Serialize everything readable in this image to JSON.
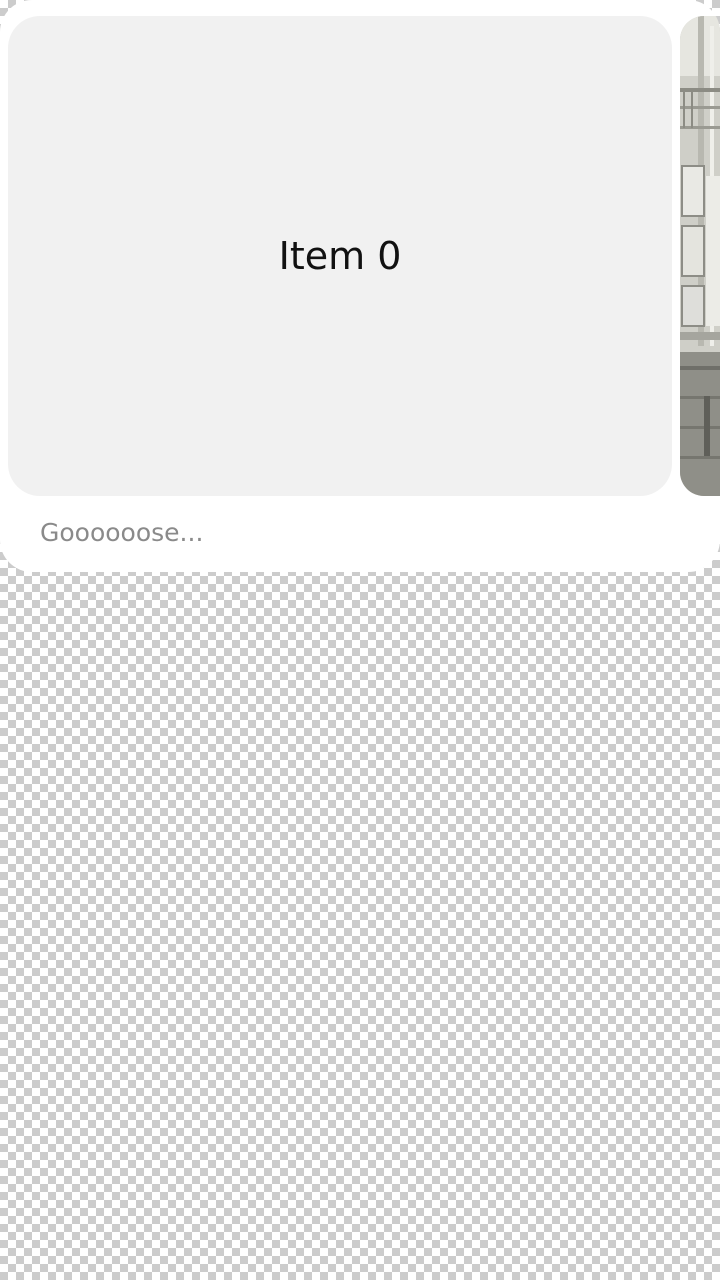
{
  "carousel": {
    "items": [
      {
        "label": "Item 0"
      }
    ],
    "next_item_image": "building-photo-thumbnail"
  },
  "caption": {
    "text": "Goooooose..."
  },
  "colors": {
    "card_background": "#ffffff",
    "slide_background": "#f1f1f1",
    "caption_text": "#8a8a8a"
  }
}
